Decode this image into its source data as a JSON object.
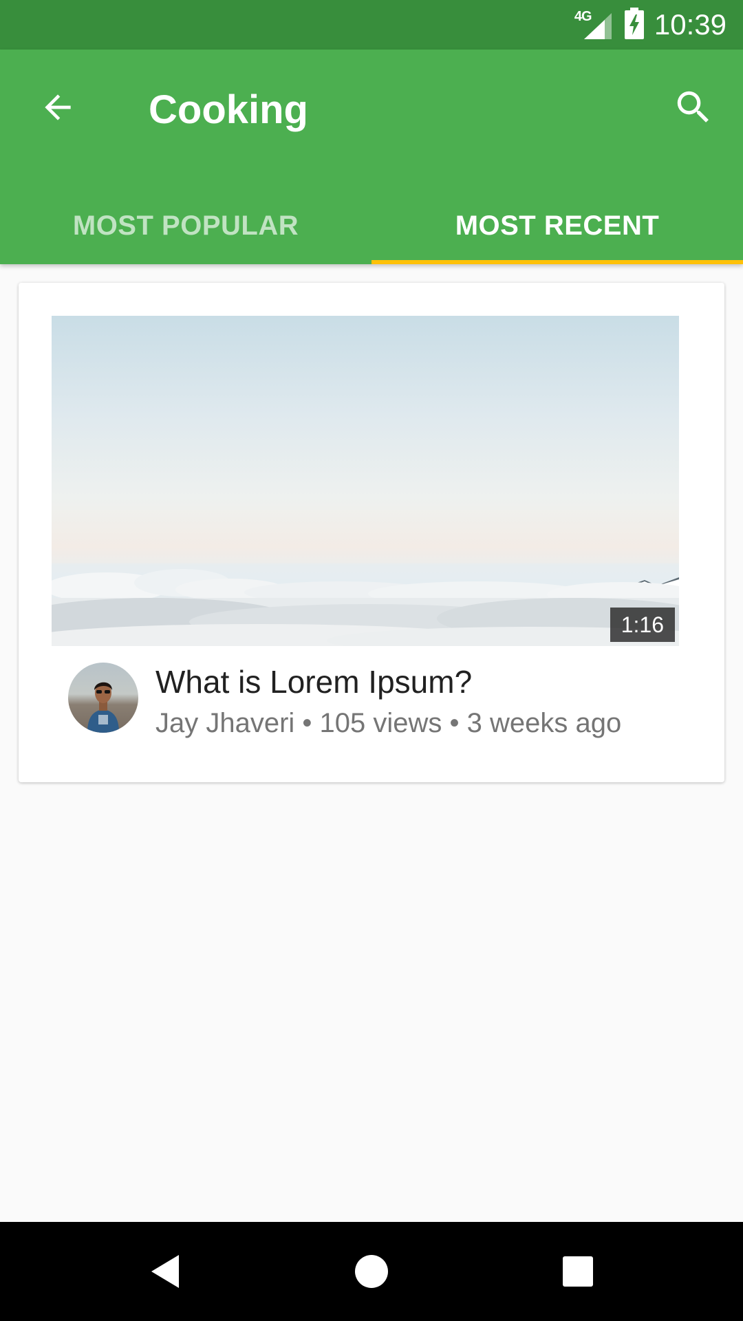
{
  "status_bar": {
    "network": "4G",
    "time": "10:39"
  },
  "app_bar": {
    "title": "Cooking",
    "back_icon": "arrow-back-icon",
    "search_icon": "search-icon"
  },
  "tabs": [
    {
      "label": "MOST POPULAR",
      "active": false
    },
    {
      "label": "MOST RECENT",
      "active": true
    }
  ],
  "video": {
    "duration": "1:16",
    "title": "What is Lorem Ipsum?",
    "meta": "Jay Jhaveri • 105 views • 3 weeks ago"
  },
  "nav_bar": {
    "back_icon": "nav-back-icon",
    "home_icon": "nav-home-icon",
    "recents_icon": "nav-recents-icon"
  },
  "colors": {
    "status_bar": "#388e3c",
    "primary": "#4caf50",
    "tab_indicator": "#ffc107"
  }
}
